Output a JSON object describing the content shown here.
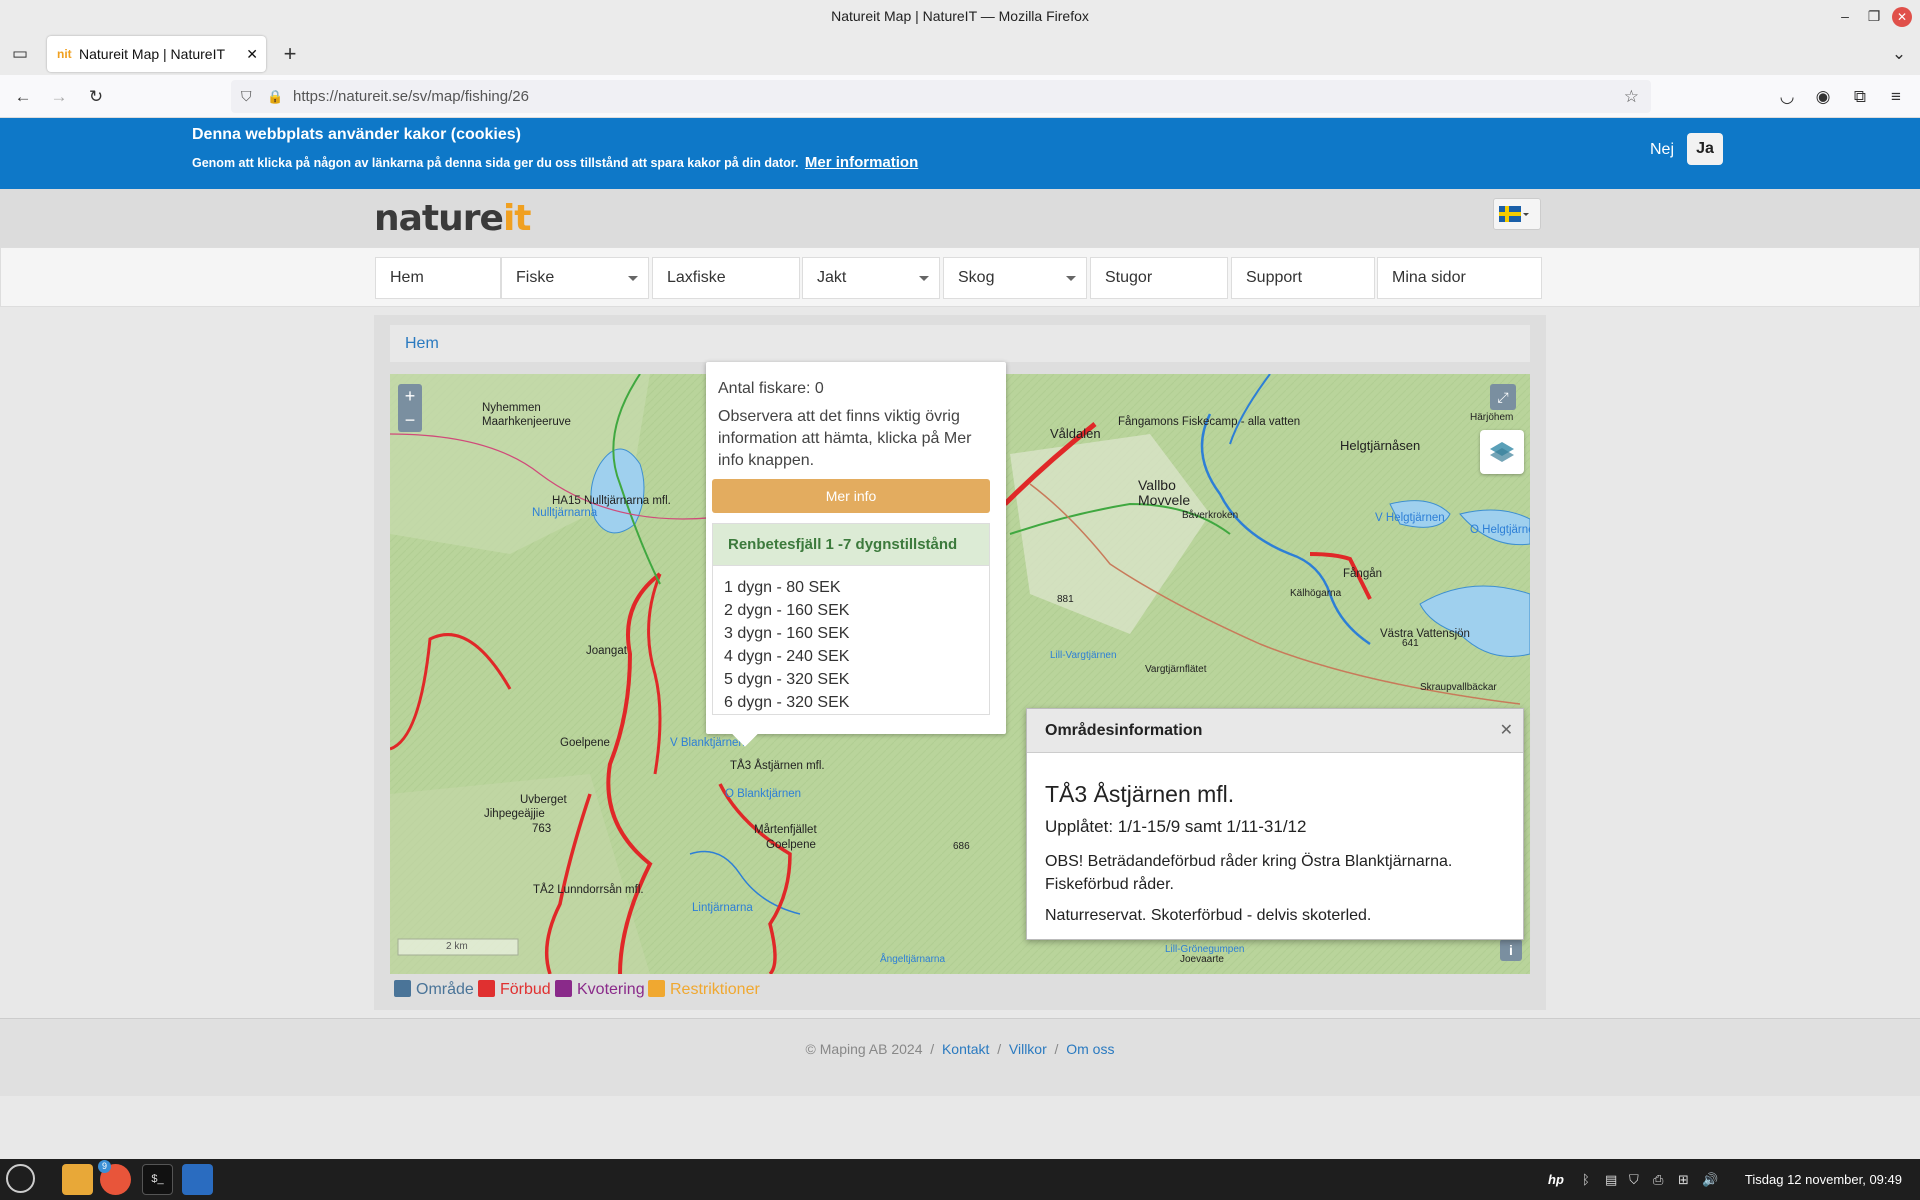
{
  "window": {
    "title": "Natureit Map | NatureIT — Mozilla Firefox"
  },
  "tab": {
    "title": "Natureit Map | NatureIT"
  },
  "url": "https://natureit.se/sv/map/fishing/26",
  "cookie": {
    "title": "Denna webbplats använder kakor (cookies)",
    "text": "Genom att klicka på någon av länkarna på denna sida ger du oss tillstånd att spara kakor på din dator.",
    "link": "Mer information",
    "no": "Nej",
    "yes": "Ja"
  },
  "logo": {
    "nature": "nature",
    "it": "it"
  },
  "menu": [
    "Hem",
    "Fiske",
    "Laxfiske",
    "Jakt",
    "Skog",
    "Stugor",
    "Support",
    "Mina sidor"
  ],
  "breadcrumb": "Hem",
  "popup": {
    "anglers": "Antal fiskare: 0",
    "note": "Observera att det finns viktig övrig information att hämta, klicka på Mer info knappen.",
    "more": "Mer info",
    "price_title": "Renbetesfjäll 1 -7 dygnstillstånd",
    "prices": [
      "1 dygn - 80 SEK",
      "2 dygn - 160 SEK",
      "3 dygn - 160 SEK",
      "4 dygn - 240 SEK",
      "5 dygn - 320 SEK",
      "6 dygn - 320 SEK"
    ]
  },
  "area": {
    "header": "Områdesinformation",
    "name": "TÅ3 Åstjärnen mfl.",
    "open": "Upplåtet: 1/1-15/9 samt 1/11-31/12",
    "obs": "OBS! Beträdandeförbud råder kring Östra Blanktjärnarna. Fiskeförbud råder.",
    "nature": "Naturreservat. Skoterförbud - delvis skoterled."
  },
  "map_labels": [
    "Nyhemmen",
    "Maarhkenjeeruve",
    "HA15 Nulltjärnarna mfl.",
    "Nulltjärnarna",
    "Joangat",
    "Goelpene",
    "Uvberget",
    "Jihpegeäjjie",
    "763",
    "TÅ2 Lunndorrsån mfl.",
    "V Blanktjärnen",
    "TÅ3 Åstjärnen mfl.",
    "O Blanktjärnen",
    "Mårtenfjället",
    "Goelpene",
    "Lintjärnarna",
    "Våldalen",
    "Fångamons Fiskecamp - alla vatten",
    "Vallbo",
    "Movvele",
    "Båverkroken",
    "Helgtjärnåsen",
    "Härjöhem",
    "V Helgtjärnen",
    "O Helgtjärnen",
    "Fångån",
    "Kälhögarna",
    "Västra Vattensjön",
    "Vargtjärnflätet",
    "Lill-Vargtjärnen",
    "Skraupvallbäckar",
    "Lill-Grönegumpen",
    "Joevaarte",
    "Ångeltjärnarna",
    "686",
    "881",
    "641",
    "2 km"
  ],
  "legend": {
    "omrade": "Område",
    "forbud": "Förbud",
    "kvotering": "Kvotering",
    "restriktioner": "Restriktioner"
  },
  "colors": {
    "omrade": "#4a7498",
    "forbud": "#e03030",
    "kvotering": "#8a2a8a",
    "restriktioner": "#f0a830"
  },
  "footer": {
    "copy": "© Maping AB 2024",
    "links": [
      "Kontakt",
      "Villkor",
      "Om oss"
    ]
  },
  "taskbar": {
    "clock": "Tisdag 12 november, 09:49",
    "badge": "9"
  }
}
